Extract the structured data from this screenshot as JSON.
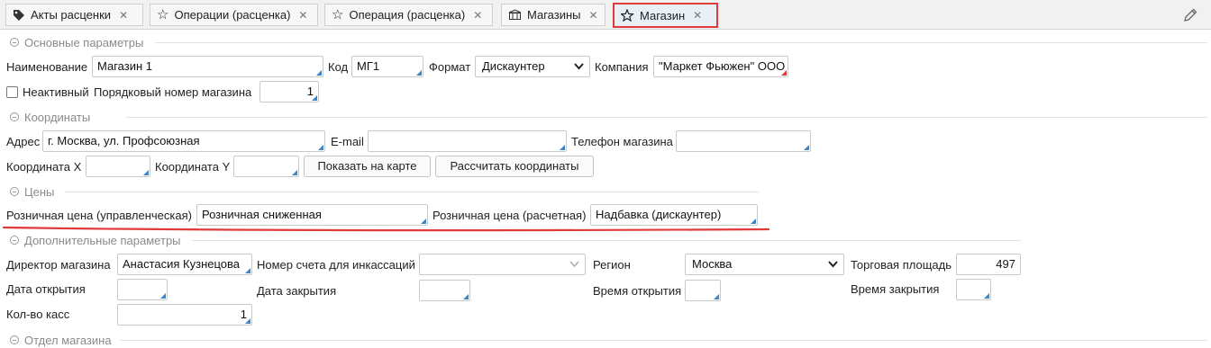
{
  "tabs": [
    {
      "label": "Акты расценки",
      "icon": "tag-icon"
    },
    {
      "label": "Операции (расценка)",
      "icon": "star-icon"
    },
    {
      "label": "Операция (расценка)",
      "icon": "star-icon"
    },
    {
      "label": "Магазины",
      "icon": "store-icon"
    },
    {
      "label": "Магазин",
      "icon": "star-edit-icon",
      "active": true
    }
  ],
  "sections": {
    "main": "Основные параметры",
    "coords": "Координаты",
    "prices": "Цены",
    "extra": "Дополнительные параметры",
    "dept": "Отдел магазина"
  },
  "main": {
    "name_label": "Наименование",
    "name_value": "Магазин 1",
    "code_label": "Код",
    "code_value": "МГ1",
    "format_label": "Формат",
    "format_value": "Дискаунтер",
    "company_label": "Компания",
    "company_value": "\"Маркет Фьюжен\" ООО",
    "inactive_label": "Неактивный",
    "order_label": "Порядковый номер магазина",
    "order_value": "1"
  },
  "coords": {
    "address_label": "Адрес",
    "address_value": "г. Москва, ул. Профсоюзная",
    "email_label": "E-mail",
    "email_value": "",
    "phone_label": "Телефон магазина",
    "phone_value": "",
    "x_label": "Координата X",
    "y_label": "Координата Y",
    "show_map_button": "Показать на карте",
    "calc_button": "Рассчитать координаты"
  },
  "prices": {
    "retail_mgmt_label": "Розничная цена (управленческая)",
    "retail_mgmt_value": "Розничная сниженная",
    "retail_calc_label": "Розничная цена (расчетная)",
    "retail_calc_value": "Надбавка (дискаунтер)"
  },
  "extra": {
    "director_label": "Директор магазина",
    "director_value": "Анастасия Кузнецова",
    "account_label": "Номер счета для инкассаций",
    "account_value": "",
    "region_label": "Регион",
    "region_value": "Москва",
    "area_label": "Торговая площадь",
    "area_value": "497",
    "open_date_label": "Дата открытия",
    "close_date_label": "Дата закрытия",
    "open_time_label": "Время открытия",
    "close_time_label": "Время закрытия",
    "registers_label": "Кол-во касс",
    "registers_value": "1"
  },
  "colors": {
    "highlight": "#e03a3a",
    "accent": "#3a86c8"
  }
}
